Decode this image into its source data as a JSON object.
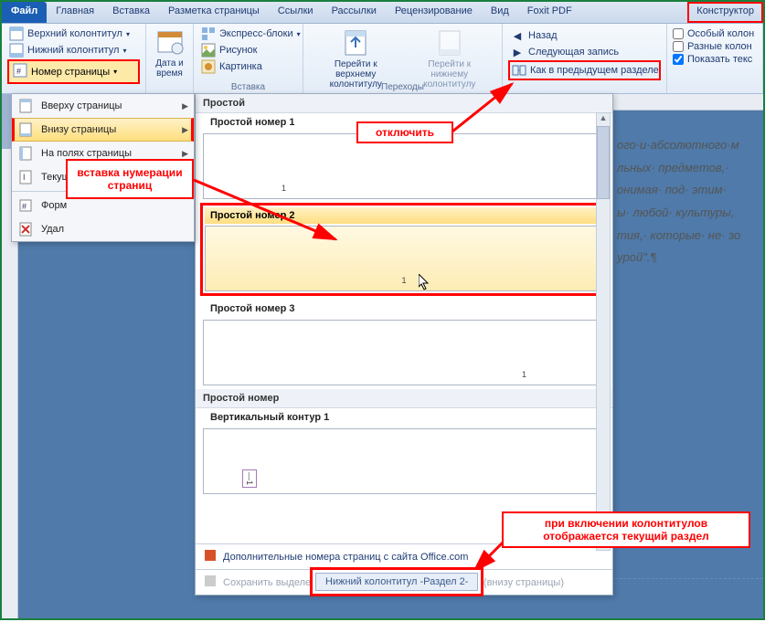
{
  "tabs": {
    "file": "Файл",
    "home": "Главная",
    "insert": "Вставка",
    "layout": "Разметка страницы",
    "refs": "Ссылки",
    "mail": "Рассылки",
    "review": "Рецензирование",
    "view": "Вид",
    "foxit": "Foxit PDF",
    "konstruktor": "Конструктор"
  },
  "ribbon": {
    "header": "Верхний колонтитул",
    "footer": "Нижний колонтитул",
    "pagenum": "Номер страницы",
    "datetime": "Дата и время",
    "express": "Экспресс-блоки",
    "picture": "Рисунок",
    "clipart": "Картинка",
    "insert_group": "Вставка",
    "goto_header": "Перейти к верхнему колонтитулу",
    "goto_footer": "Перейти к нижнему колонтитулу",
    "transitions_group": "Переходы",
    "back": "Назад",
    "next_record": "Следующая запись",
    "same_as_prev": "Как в предыдущем разделе",
    "special_header": "Особый колон",
    "diff_headers": "Разные колон",
    "show_text": "Показать текс"
  },
  "menu": {
    "top": "Вверху страницы",
    "bottom": "Внизу страницы",
    "margins": "На полях страницы",
    "current": "Текущ",
    "format": "Форм",
    "remove": "Удал"
  },
  "callouts": {
    "insert_numbering": "вставка нумерации страниц",
    "disable": "отключить",
    "footer_section": "при включении колонтитулов отображается текущий раздел"
  },
  "gallery": {
    "simple_header": "Простой",
    "item1": "Простой номер 1",
    "item2": "Простой номер 2",
    "item3": "Простой номер 3",
    "simple_num_header": "Простой номер",
    "item4": "Вертикальный контур 1",
    "more": "Дополнительные номера страниц с сайта Office.com",
    "save": "Сохранить выделенный фрагмент как номер страницы (внизу страницы)"
  },
  "footer_tab": "Нижний колонтитул -Раздел 2-",
  "doc_text": {
    "l1": "ого·и·абсолютного·м",
    "l2": "льных· предметов,·",
    "l3": "онимая· под· этим·",
    "l4": "ы· любой· культуры,",
    "l5": "тия,· которые· не· зо",
    "l6": "урой\".¶"
  }
}
